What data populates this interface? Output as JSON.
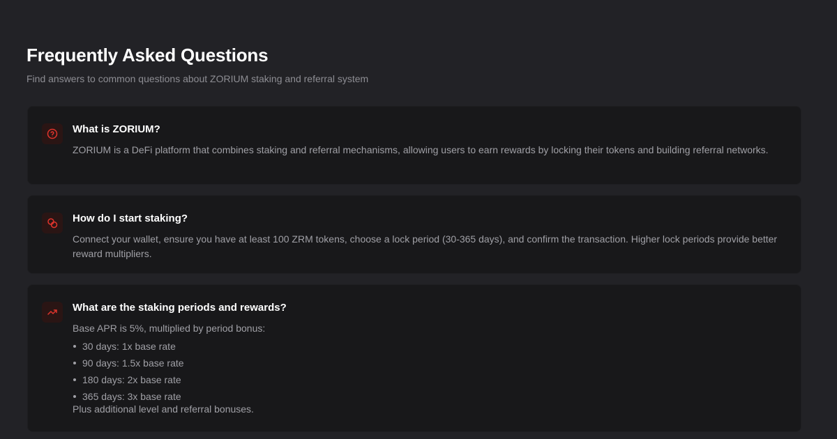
{
  "header": {
    "title": "Frequently Asked Questions",
    "subtitle": "Find answers to common questions about ZORIUM staking and referral system"
  },
  "colors": {
    "background": "#222226",
    "card": "#18181a",
    "accent": "#e0342c",
    "icon_bg": "#2a1514"
  },
  "faq": [
    {
      "icon": "question-circle-icon",
      "question": "What is ZORIUM?",
      "answer": "ZORIUM is a DeFi platform that combines staking and referral mechanisms, allowing users to earn rewards by locking their tokens and building referral networks."
    },
    {
      "icon": "coins-icon",
      "question": "How do I start staking?",
      "answer": "Connect your wallet, ensure you have at least 100 ZRM tokens, choose a lock period (30-365 days), and confirm the transaction. Higher lock periods provide better reward multipliers."
    },
    {
      "icon": "trending-up-icon",
      "question": "What are the staking periods and rewards?",
      "answer_intro": "Base APR is 5%, multiplied by period bonus:",
      "rates": [
        "30 days: 1x base rate",
        "90 days: 1.5x base rate",
        "180 days: 2x base rate",
        "365 days: 3x base rate"
      ],
      "answer_outro": "Plus additional level and referral bonuses."
    }
  ]
}
